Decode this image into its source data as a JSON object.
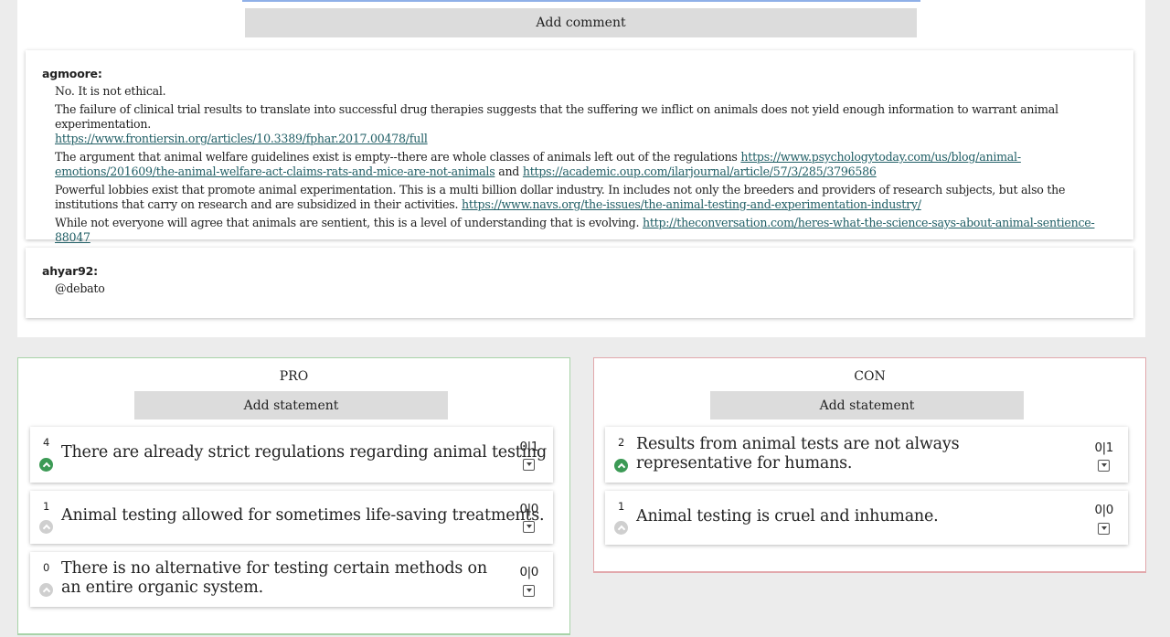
{
  "add_comment_label": "Add comment",
  "comments": [
    {
      "author": "agmoore:",
      "paragraphs": [
        {
          "text": "No. It is not ethical."
        },
        {
          "text": "The failure of clinical trial results to translate into successful drug therapies suggests that the suffering we inflict on animals does not yield enough information to warrant animal experimentation.",
          "link": "https://www.frontiersin.org/articles/10.3389/fphar.2017.00478/full"
        },
        {
          "text": "The argument that animal welfare guidelines exist is empty--there are whole classes of animals left out of the regulations",
          "link": "https://www.psychologytoday.com/us/blog/animal-emotions/201609/the-animal-welfare-act-claims-rats-and-mice-are-not-animals",
          "mid": "and",
          "link2": "https://academic.oup.com/ilarjournal/article/57/3/285/3796586"
        },
        {
          "text": "Powerful lobbies exist that promote animal experimentation. This is a multi billion dollar industry. In includes not only the breeders and providers of research subjects, but also the institutions that carry on research and are subsidized in their activities.",
          "link": "https://www.navs.org/the-issues/the-animal-testing-and-experimentation-industry/"
        },
        {
          "text": "While not everyone will agree that animals are sentient, this is a level of understanding that is evolving.",
          "link": "http://theconversation.com/heres-what-the-science-says-about-animal-sentience-88047"
        }
      ]
    },
    {
      "author": "ahyar92:",
      "paragraphs": [
        {
          "text": "@debato"
        }
      ]
    }
  ],
  "pro": {
    "title": "PRO",
    "add_label": "Add statement",
    "statements": [
      {
        "count": "4",
        "text": "There are already strict regulations regarding animal testing",
        "score": "0|1",
        "voted": true
      },
      {
        "count": "1",
        "text": "Animal testing allowed for sometimes life-saving treatments.",
        "score": "0|0",
        "voted": false
      },
      {
        "count": "0",
        "text": "There is no alternative for testing certain methods on an entire organic system.",
        "score": "0|0",
        "voted": false
      }
    ]
  },
  "con": {
    "title": "CON",
    "add_label": "Add statement",
    "statements": [
      {
        "count": "2",
        "text": "Results from animal tests are not always representative for humans.",
        "score": "0|1",
        "voted": true
      },
      {
        "count": "1",
        "text": "Animal testing is cruel and inhumane.",
        "score": "0|0",
        "voted": false
      }
    ]
  },
  "colors": {
    "accent_green": "#3c9a55",
    "pro_border": "#a8d3a8",
    "con_border": "#e2a8ac",
    "link": "#215f66",
    "button_bg": "#dcdcdc"
  }
}
